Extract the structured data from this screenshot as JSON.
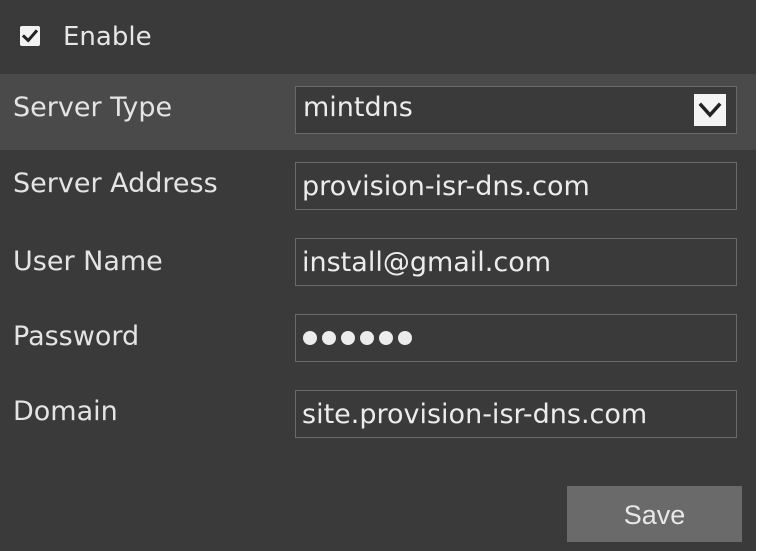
{
  "enable": {
    "label": "Enable",
    "checked": true
  },
  "server_type": {
    "label": "Server Type",
    "value": "mintdns"
  },
  "server_address": {
    "label": "Server Address",
    "value": "provision-isr-dns.com"
  },
  "user_name": {
    "label": "User Name",
    "value": "install@gmail.com"
  },
  "password": {
    "label": "Password",
    "masked_length": 6
  },
  "domain": {
    "label": "Domain",
    "value": "site.provision-isr-dns.com"
  },
  "save_label": "Save",
  "icons": {
    "checkbox": "checkmark-icon",
    "dropdown": "chevron-down-icon"
  },
  "colors": {
    "panel_bg": "#3a3a3a",
    "highlight_row": "#4a4a4a",
    "button_bg": "#6a6a6a",
    "text": "#e6e6e6"
  }
}
